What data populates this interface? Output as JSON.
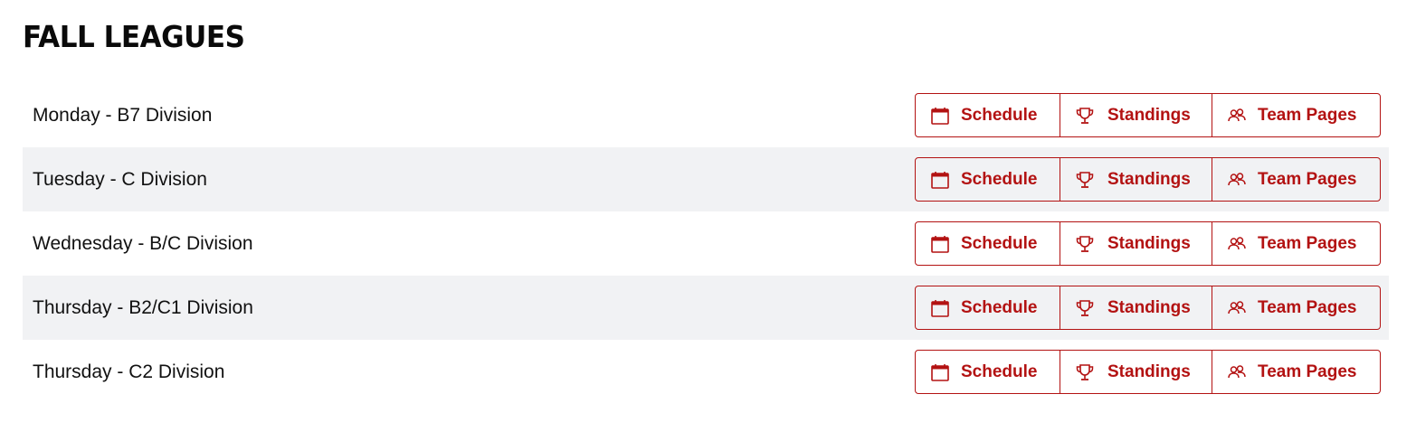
{
  "page": {
    "title": "FALL LEAGUES"
  },
  "colors": {
    "accent": "#b31212",
    "row_shade": "#f1f2f4"
  },
  "buttons": {
    "schedule": {
      "label": "Schedule",
      "icon": "calendar-icon"
    },
    "standings": {
      "label": "Standings",
      "icon": "trophy-icon"
    },
    "teams": {
      "label": "Team Pages",
      "icon": "people-icon"
    }
  },
  "leagues": [
    {
      "name": "Monday - B7 Division"
    },
    {
      "name": "Tuesday - C Division"
    },
    {
      "name": "Wednesday - B/C Division"
    },
    {
      "name": "Thursday - B2/C1 Division"
    },
    {
      "name": "Thursday - C2 Division"
    }
  ]
}
